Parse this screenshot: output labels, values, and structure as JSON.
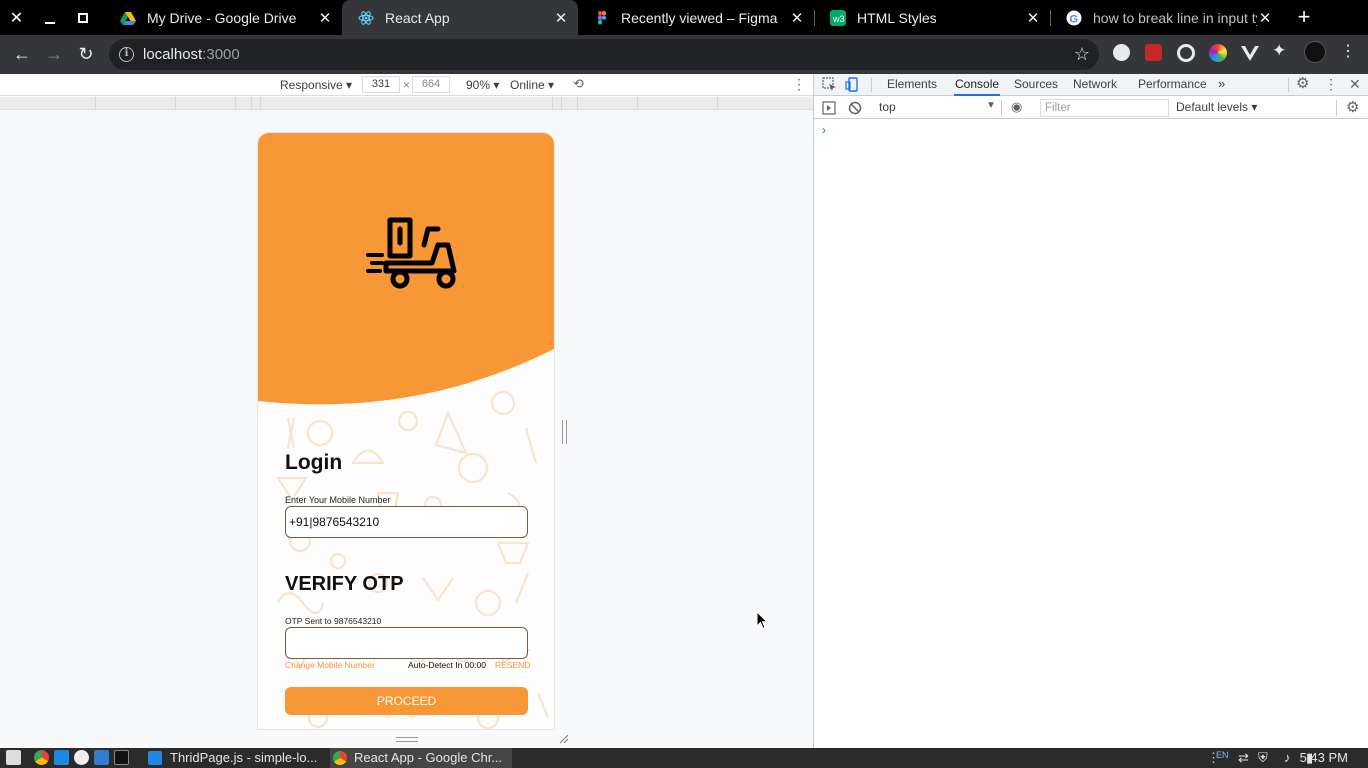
{
  "window_controls": [
    "close",
    "minimize",
    "restore"
  ],
  "tabs": [
    {
      "title": "My Drive - Google Drive",
      "icon": "google-drive-icon",
      "active": false
    },
    {
      "title": "React App",
      "icon": "react-icon",
      "active": true
    },
    {
      "title": "Recently viewed – Figma",
      "icon": "figma-icon",
      "active": false
    },
    {
      "title": "HTML Styles",
      "icon": "w3schools-icon",
      "active": false
    },
    {
      "title": "how to break line in input typ",
      "icon": "google-icon",
      "active": false
    }
  ],
  "address_bar": {
    "host": "localhost",
    "port": ":3000"
  },
  "device_toolbar": {
    "mode": "Responsive",
    "width": "331",
    "height": "664",
    "zoom": "90%",
    "network": "Online"
  },
  "app": {
    "login_title": "Login",
    "mobile_label": "Enter Your Mobile Number",
    "mobile_value": "+91|9876543210",
    "otp_title": "VERIFY OTP",
    "otp_sent_label": "OTP Sent to 9876543210",
    "otp_value": "",
    "change_mobile": "Change Mobile Number",
    "auto_detect": "Auto-Detect In 00:00",
    "resend": "RESEND",
    "proceed": "PROCEED",
    "accent": "#f79736"
  },
  "devtools": {
    "tabs": [
      "Elements",
      "Console",
      "Sources",
      "Network",
      "Performance"
    ],
    "active_tab": "Console",
    "context": "top",
    "filter_placeholder": "Filter",
    "levels": "Default levels"
  },
  "taskbar": {
    "items": [
      "ThridPage.js - simple-lo...",
      "React App - Google Chr..."
    ],
    "clock": "5:43 PM",
    "lang": "EN"
  }
}
